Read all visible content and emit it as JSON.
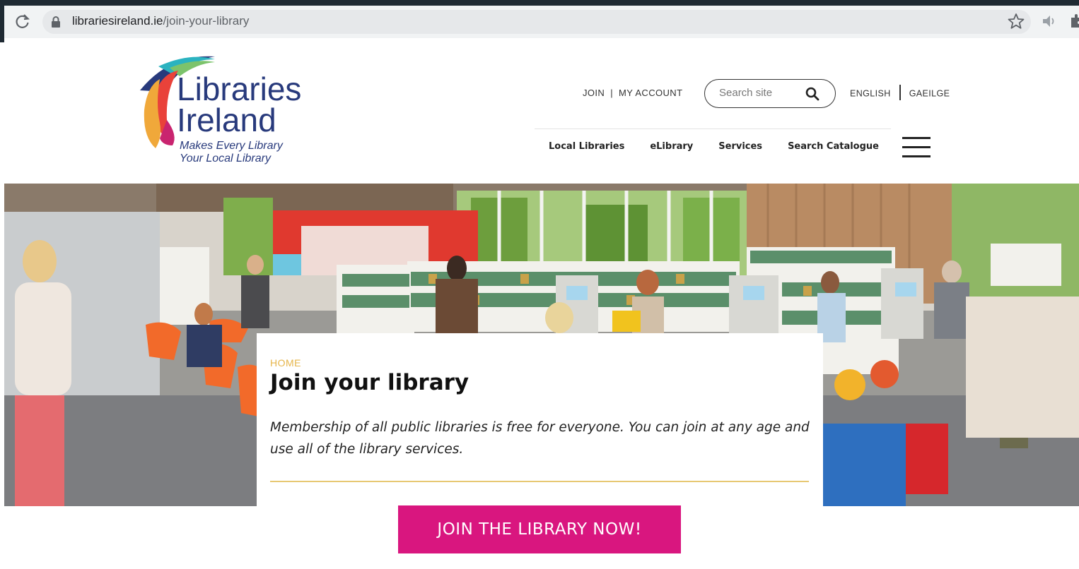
{
  "browser": {
    "url_host": "librariesireland.ie",
    "url_path": "/join-your-library",
    "icons": [
      "reload-icon",
      "lock-icon",
      "star-icon",
      "speaker-icon",
      "extension-icon"
    ]
  },
  "header": {
    "logo": {
      "line1": "Libraries",
      "line2": "Ireland",
      "tagline1": "Makes Every Library",
      "tagline2": "Your Local Library"
    },
    "util_nav": {
      "join": "JOIN",
      "sep": "|",
      "account": "MY ACCOUNT"
    },
    "search": {
      "placeholder": "Search site"
    },
    "lang_nav": {
      "english": "ENGLISH",
      "gaeilge": "GAEILGE"
    },
    "main_nav": [
      "Local Libraries",
      "eLibrary",
      "Services",
      "Search Catalogue"
    ]
  },
  "hero_card": {
    "breadcrumb": "HOME",
    "title": "Join your library",
    "intro": "Membership of all public libraries is free for everyone. You can join at any age and use all of the library services."
  },
  "cta": {
    "label": "JOIN THE LIBRARY NOW!"
  },
  "colors": {
    "accent_pink": "#d9167f",
    "breadcrumb_gold": "#e6b54a",
    "rule_gold": "#e7c873",
    "logo_navy": "#283a7c"
  }
}
